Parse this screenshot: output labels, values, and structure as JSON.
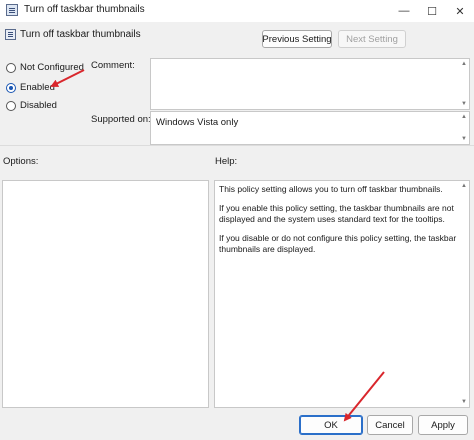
{
  "window": {
    "title": "Turn off taskbar thumbnails",
    "minimize_glyph": "—",
    "maximize_glyph": "☐",
    "close_glyph": "✕"
  },
  "header": {
    "policy_name": "Turn off taskbar thumbnails",
    "previous_label": "Previous Setting",
    "next_label": "Next Setting"
  },
  "state": {
    "options": [
      {
        "label": "Not Configured",
        "checked": false
      },
      {
        "label": "Enabled",
        "checked": true
      },
      {
        "label": "Disabled",
        "checked": false
      }
    ]
  },
  "comment": {
    "label": "Comment:",
    "value": ""
  },
  "supported": {
    "label": "Supported on:",
    "value": "Windows Vista only"
  },
  "options_section": {
    "label": "Options:"
  },
  "help_section": {
    "label": "Help:",
    "paragraphs": [
      "This policy setting allows you to turn off taskbar thumbnails.",
      "If you enable this policy setting, the taskbar thumbnails are not displayed and the system uses standard text for the tooltips.",
      "If you disable or do not configure this policy setting, the taskbar thumbnails are displayed."
    ]
  },
  "footer": {
    "ok_label": "OK",
    "cancel_label": "Cancel",
    "apply_label": "Apply"
  },
  "annotations": {
    "arrow_color": "#d9262c"
  }
}
